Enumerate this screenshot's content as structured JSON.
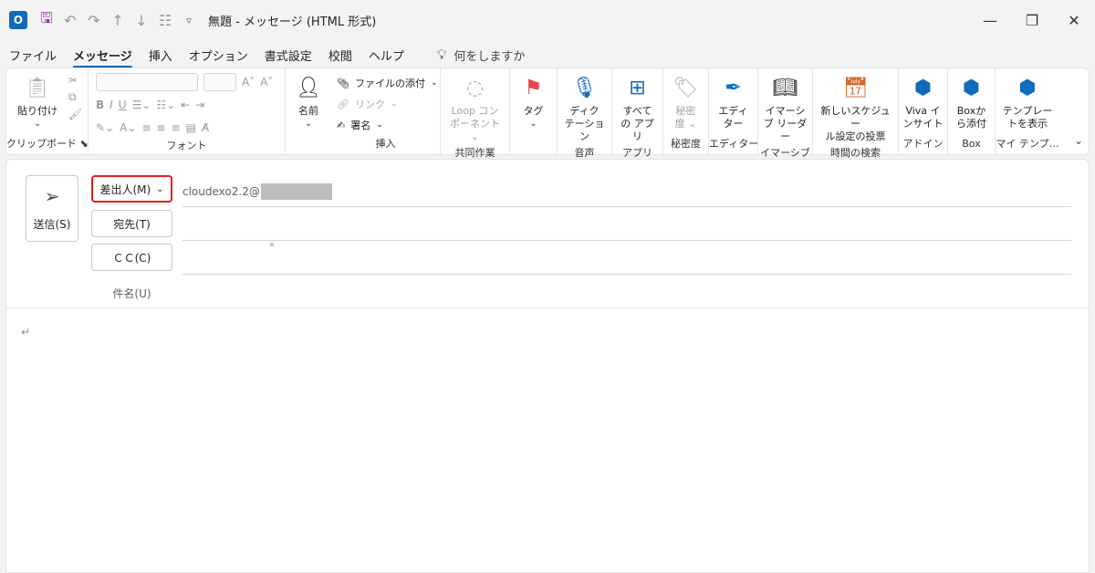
{
  "titlebar": {
    "title": "無題 - メッセージ (HTML 形式)",
    "icons": [
      "outlook-icon",
      "save-icon",
      "undo-icon",
      "redo-icon",
      "up-icon",
      "down-icon",
      "form-icon",
      "customize-icon"
    ]
  },
  "menu": {
    "tabs": [
      "ファイル",
      "メッセージ",
      "挿入",
      "オプション",
      "書式設定",
      "校閲",
      "ヘルプ"
    ],
    "active": "メッセージ",
    "tell_me": "何をしますか"
  },
  "ribbon": {
    "clipboard": {
      "paste": "貼り付け",
      "name": "クリップボード"
    },
    "font": {
      "name": "フォント"
    },
    "insert": {
      "attach": "ファイルの添付",
      "link": "リンク",
      "signature": "署名",
      "name_btn": "名前",
      "name": "挿入"
    },
    "collab": {
      "loop_line1": "Loop コン",
      "loop_line2": "ポーネント",
      "name": "共同作業"
    },
    "tags": {
      "tag": "タグ",
      "name": ""
    },
    "voice": {
      "line1": "ディク",
      "line2": "テーション",
      "name": "音声"
    },
    "apps": {
      "line1": "すべて",
      "line2": "の アプリ",
      "name": "アプリ"
    },
    "sensitivity": {
      "line1": "秘密",
      "line2": "度",
      "name": "秘密度"
    },
    "editor": {
      "line1": "エディ",
      "line2": "ター",
      "name": "エディター"
    },
    "immersive": {
      "line1": "イマーシ",
      "line2": "ブ リーダー",
      "name": "イマーシブ"
    },
    "schedule": {
      "line1": "新しいスケジュー",
      "line2": "ル設定の投票",
      "name": "時間の検索"
    },
    "addin": {
      "line1": "Viva イ",
      "line2": "ンサイト",
      "name": "アドイン"
    },
    "box": {
      "line1": "Boxか",
      "line2": "ら添付",
      "name": "Box"
    },
    "templates": {
      "line1": "テンプレー",
      "line2": "トを表示",
      "name": "マイ テンプ…"
    }
  },
  "compose": {
    "send": "送信(S)",
    "from": "差出人(M)",
    "from_value": "cloudexo2.2@",
    "to": "宛先(T)",
    "cc": "ＣＣ(C)",
    "subject": "件名(U)",
    "body_mark": "↵"
  }
}
